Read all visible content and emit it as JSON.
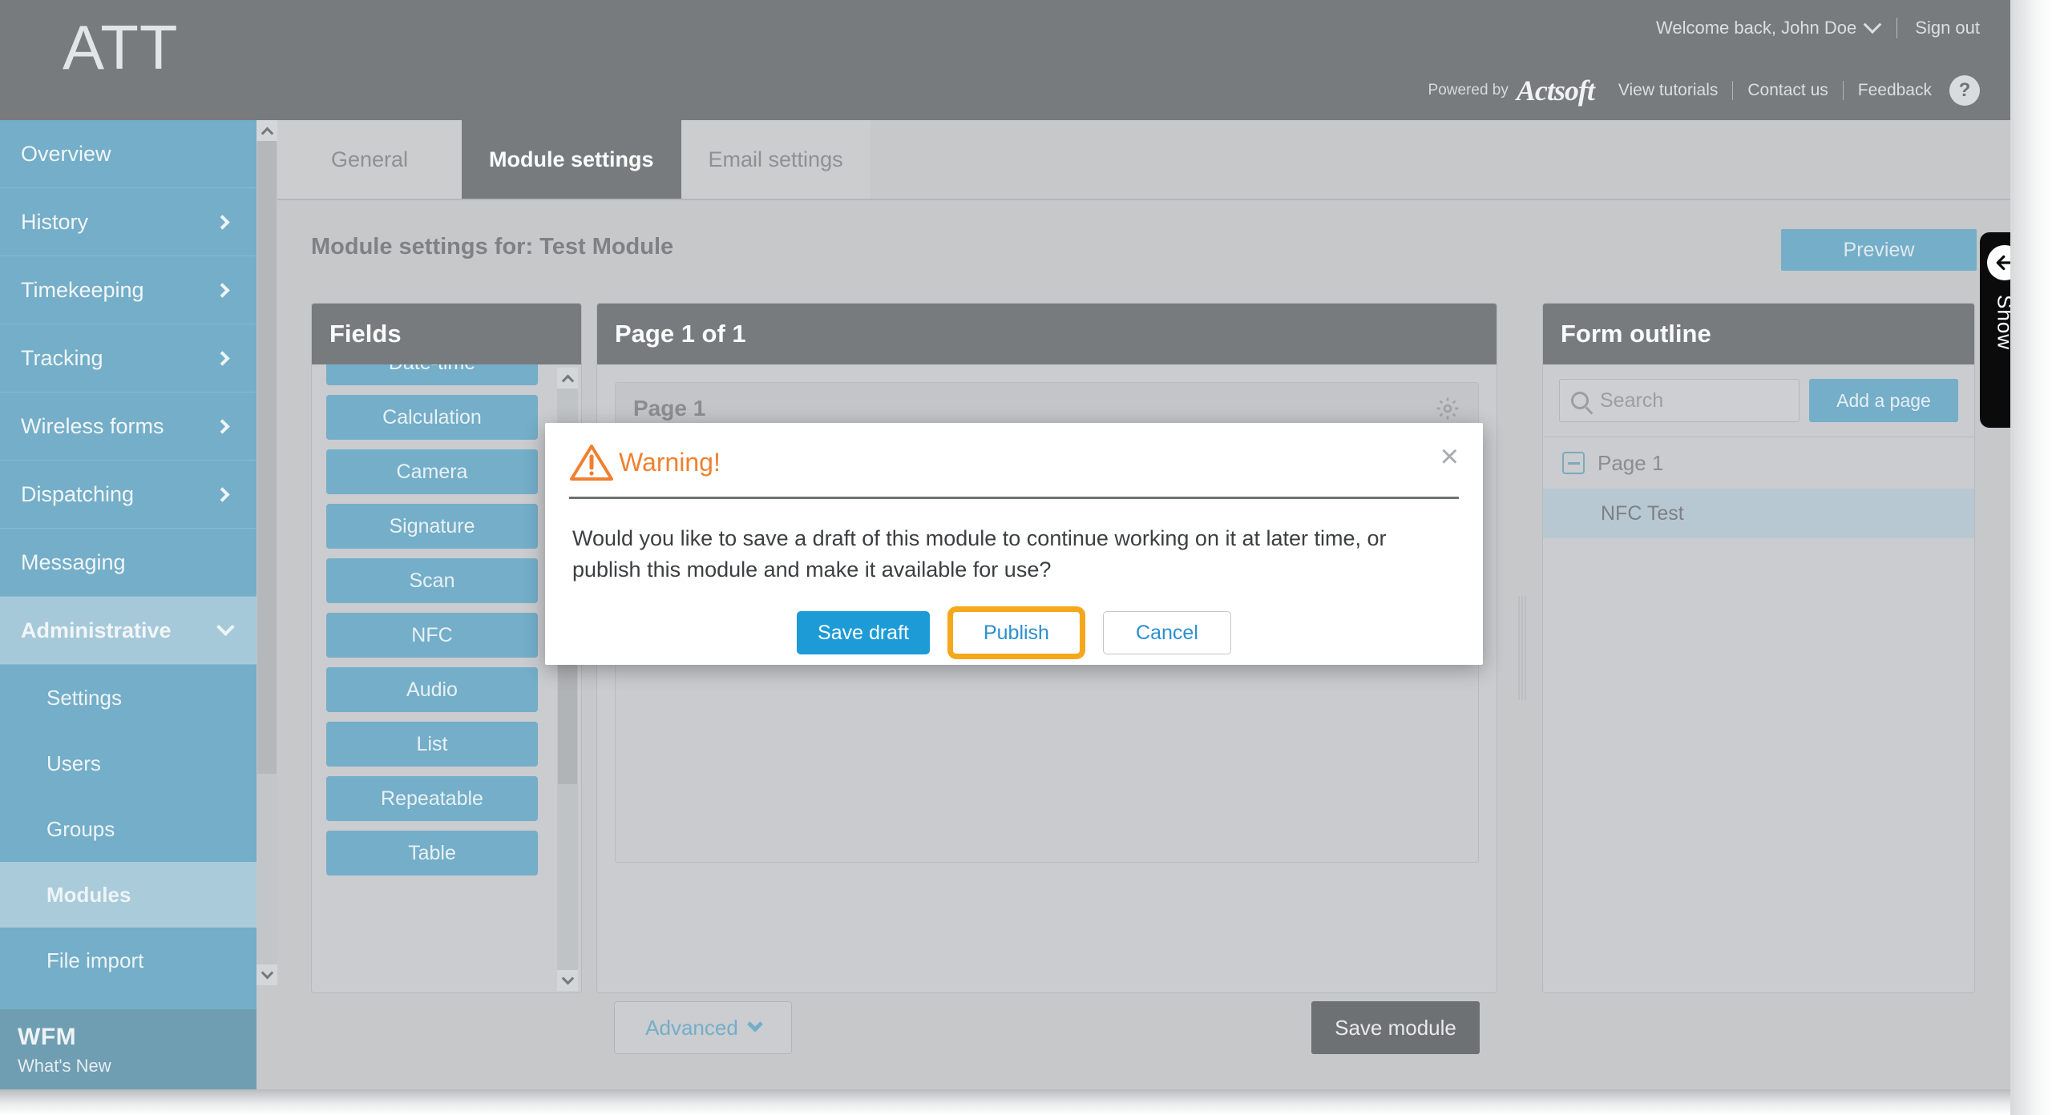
{
  "header": {
    "logo": "ATT",
    "welcome": "Welcome back, John Doe",
    "sign_out": "Sign out",
    "powered_by": "Powered by",
    "brand": "Actsoft",
    "links": [
      "View tutorials",
      "Contact us",
      "Feedback"
    ],
    "help": "?"
  },
  "sidebar": {
    "items": [
      {
        "label": "Overview",
        "caret": "none"
      },
      {
        "label": "History",
        "caret": "right"
      },
      {
        "label": "Timekeeping",
        "caret": "right"
      },
      {
        "label": "Tracking",
        "caret": "right"
      },
      {
        "label": "Wireless forms",
        "caret": "right"
      },
      {
        "label": "Dispatching",
        "caret": "right"
      },
      {
        "label": "Messaging",
        "caret": "none"
      },
      {
        "label": "Administrative",
        "caret": "down"
      }
    ],
    "sub_items": [
      {
        "label": "Settings"
      },
      {
        "label": "Users"
      },
      {
        "label": "Groups"
      },
      {
        "label": "Modules"
      },
      {
        "label": "File import"
      }
    ],
    "footer_title": "WFM",
    "footer_sub": "What's New"
  },
  "tabs": [
    {
      "label": "General"
    },
    {
      "label": "Module settings"
    },
    {
      "label": "Email settings"
    }
  ],
  "content": {
    "page_title": "Module settings for: Test Module",
    "preview_label": "Preview"
  },
  "fields_panel": {
    "title": "Fields",
    "items": [
      "Date-time",
      "Calculation",
      "Camera",
      "Signature",
      "Scan",
      "NFC",
      "Audio",
      "List",
      "Repeatable",
      "Table"
    ]
  },
  "page_canvas": {
    "title": "Page 1 of 1",
    "card_title": "Page 1",
    "advanced_label": "Advanced",
    "save_module_label": "Save module"
  },
  "outline": {
    "title": "Form outline",
    "search_placeholder": "Search",
    "search_value": "",
    "add_page_label": "Add a page",
    "tree_root": "Page 1",
    "tree_child": "NFC Test"
  },
  "show_tab": {
    "label": "Show"
  },
  "modal": {
    "title": "Warning!",
    "close": "×",
    "body": "Would you like to save a draft of this module to continue working on it at later time, or publish this module and make it available for use?",
    "save_draft": "Save draft",
    "publish": "Publish",
    "cancel": "Cancel"
  },
  "colors": {
    "brand_blue": "#74aec8",
    "header_gray": "#787b7e",
    "page_bg": "#c6c8ca",
    "accent_blue": "#1d9bd7",
    "focus_amber": "#f5a81c",
    "warning_orange": "#ef8130"
  }
}
